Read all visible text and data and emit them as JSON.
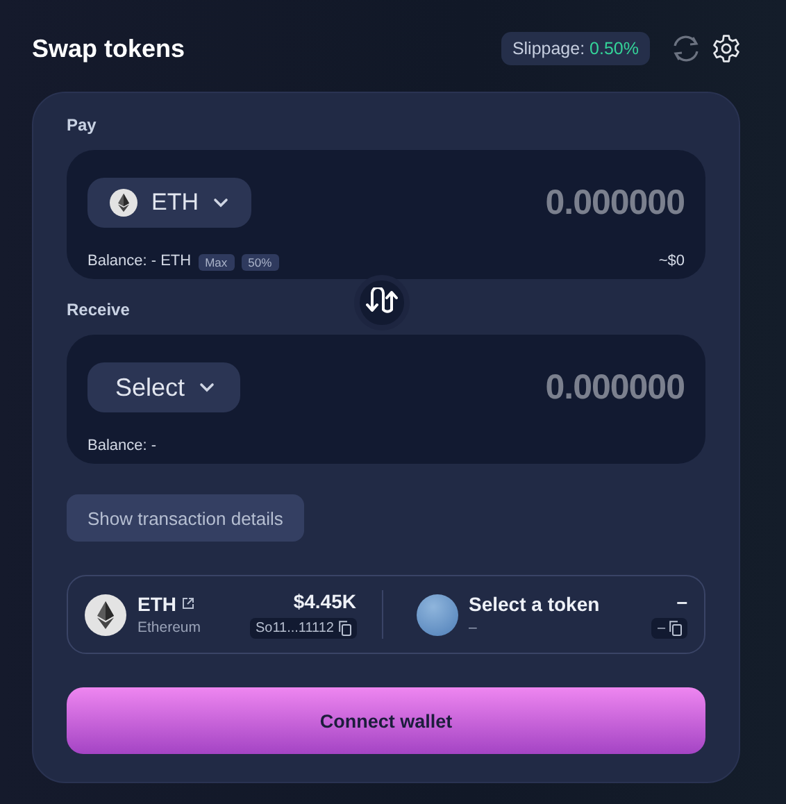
{
  "header": {
    "title": "Swap tokens",
    "slippage_label": "Slippage:",
    "slippage_value": "0.50%"
  },
  "pay": {
    "label": "Pay",
    "token": "ETH",
    "kind": "eth",
    "amount": "0.000000",
    "balance": "Balance: - ETH",
    "chips": [
      "Max",
      "50%"
    ],
    "usd": "~$0"
  },
  "receive": {
    "label": "Receive",
    "kind": "select",
    "token": "Select",
    "amount": "0.000000",
    "balance": "Balance: -"
  },
  "details_button": "Show transaction details",
  "token_info": [
    {
      "kind": "eth",
      "symbol": "ETH",
      "name": "Ethereum",
      "price": "$4.45K",
      "address": "So11...11112",
      "link": true
    },
    {
      "kind": "placeholder",
      "symbol": "Select a token",
      "name": "–",
      "price": "–",
      "address": "–",
      "link": false
    }
  ],
  "connect_button": "Connect wallet"
}
